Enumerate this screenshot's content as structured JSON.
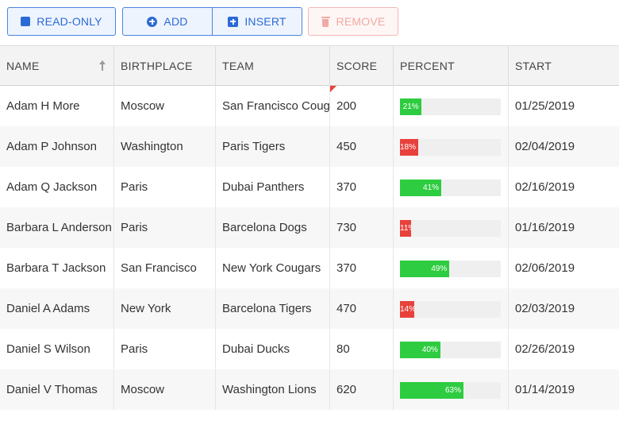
{
  "toolbar": {
    "readonly_label": "READ-ONLY",
    "add_label": "ADD",
    "insert_label": "INSERT",
    "remove_label": "REMOVE"
  },
  "columns": [
    "NAME",
    "BIRTHPLACE",
    "TEAM",
    "SCORE",
    "PERCENT",
    "START"
  ],
  "rows": [
    {
      "name": "Adam H More",
      "birthplace": "Moscow",
      "team": "San Francisco Cougars",
      "score": "200",
      "percent": 21,
      "percent_label": "21%",
      "start": "01/25/2019"
    },
    {
      "name": "Adam P Johnson",
      "birthplace": "Washington",
      "team": "Paris Tigers",
      "score": "450",
      "percent": 18,
      "percent_label": "18%",
      "start": "02/04/2019"
    },
    {
      "name": "Adam Q Jackson",
      "birthplace": "Paris",
      "team": "Dubai Panthers",
      "score": "370",
      "percent": 41,
      "percent_label": "41%",
      "start": "02/16/2019"
    },
    {
      "name": "Barbara L Anderson",
      "birthplace": "Paris",
      "team": "Barcelona Dogs",
      "score": "730",
      "percent": 11,
      "percent_label": "11%",
      "start": "01/16/2019"
    },
    {
      "name": "Barbara T Jackson",
      "birthplace": "San Francisco",
      "team": "New York Cougars",
      "score": "370",
      "percent": 49,
      "percent_label": "49%",
      "start": "02/06/2019"
    },
    {
      "name": "Daniel A Adams",
      "birthplace": "New York",
      "team": "Barcelona Tigers",
      "score": "470",
      "percent": 14,
      "percent_label": "14%",
      "start": "02/03/2019"
    },
    {
      "name": "Daniel S Wilson",
      "birthplace": "Paris",
      "team": "Dubai Ducks",
      "score": "80",
      "percent": 40,
      "percent_label": "40%",
      "start": "02/26/2019"
    },
    {
      "name": "Daniel V Thomas",
      "birthplace": "Moscow",
      "team": "Washington Lions",
      "score": "620",
      "percent": 63,
      "percent_label": "63%",
      "start": "01/14/2019"
    }
  ],
  "colors": {
    "accent": "#2a6ad6",
    "bar_high": "#2ecc40",
    "bar_low": "#e8413b",
    "remove": "#f0a9a4"
  },
  "icons": {
    "readonly": "square-icon",
    "add": "plus-circle-icon",
    "insert": "plus-square-icon",
    "remove": "trash-icon",
    "sort": "sort-ascending-icon"
  }
}
